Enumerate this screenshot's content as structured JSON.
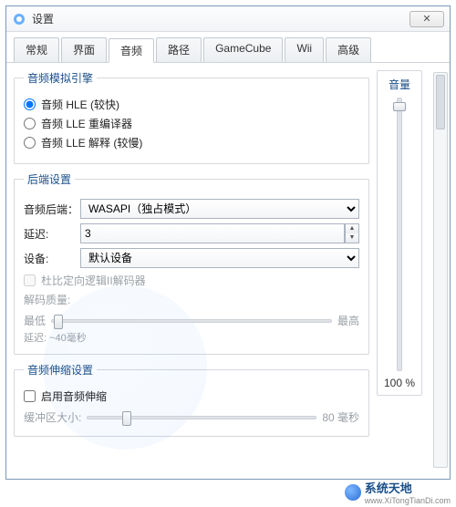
{
  "window": {
    "title": "设置"
  },
  "tabs": [
    "常规",
    "界面",
    "音频",
    "路径",
    "GameCube",
    "Wii",
    "高级"
  ],
  "active_tab_index": 2,
  "audio_engine": {
    "legend": "音频模拟引擎",
    "options": [
      {
        "label": "音频 HLE (较快)",
        "checked": true
      },
      {
        "label": "音频 LLE 重编译器",
        "checked": false
      },
      {
        "label": "音频 LLE 解释 (较慢)",
        "checked": false
      }
    ]
  },
  "backend": {
    "legend": "后端设置",
    "backend_label": "音频后端：",
    "backend_value": "WASAPI（独占模式）",
    "latency_label": "延迟:",
    "latency_value": "3",
    "device_label": "设备:",
    "device_value": "默认设备",
    "dolby_label": "杜比定向逻辑II解码器",
    "decode_quality_label": "解码质量:",
    "quality_min": "最低",
    "quality_max": "最高",
    "latency_note": "延迟: ~40毫秒"
  },
  "stretch": {
    "legend": "音频伸缩设置",
    "enable_label": "启用音频伸缩",
    "buffer_label": "缓冲区大小:",
    "buffer_value": "80 毫秒"
  },
  "volume": {
    "legend": "音量",
    "value_text": "100 %"
  },
  "watermark": {
    "brand": "系统天地",
    "url": "www.XiTongTianDi.com"
  }
}
